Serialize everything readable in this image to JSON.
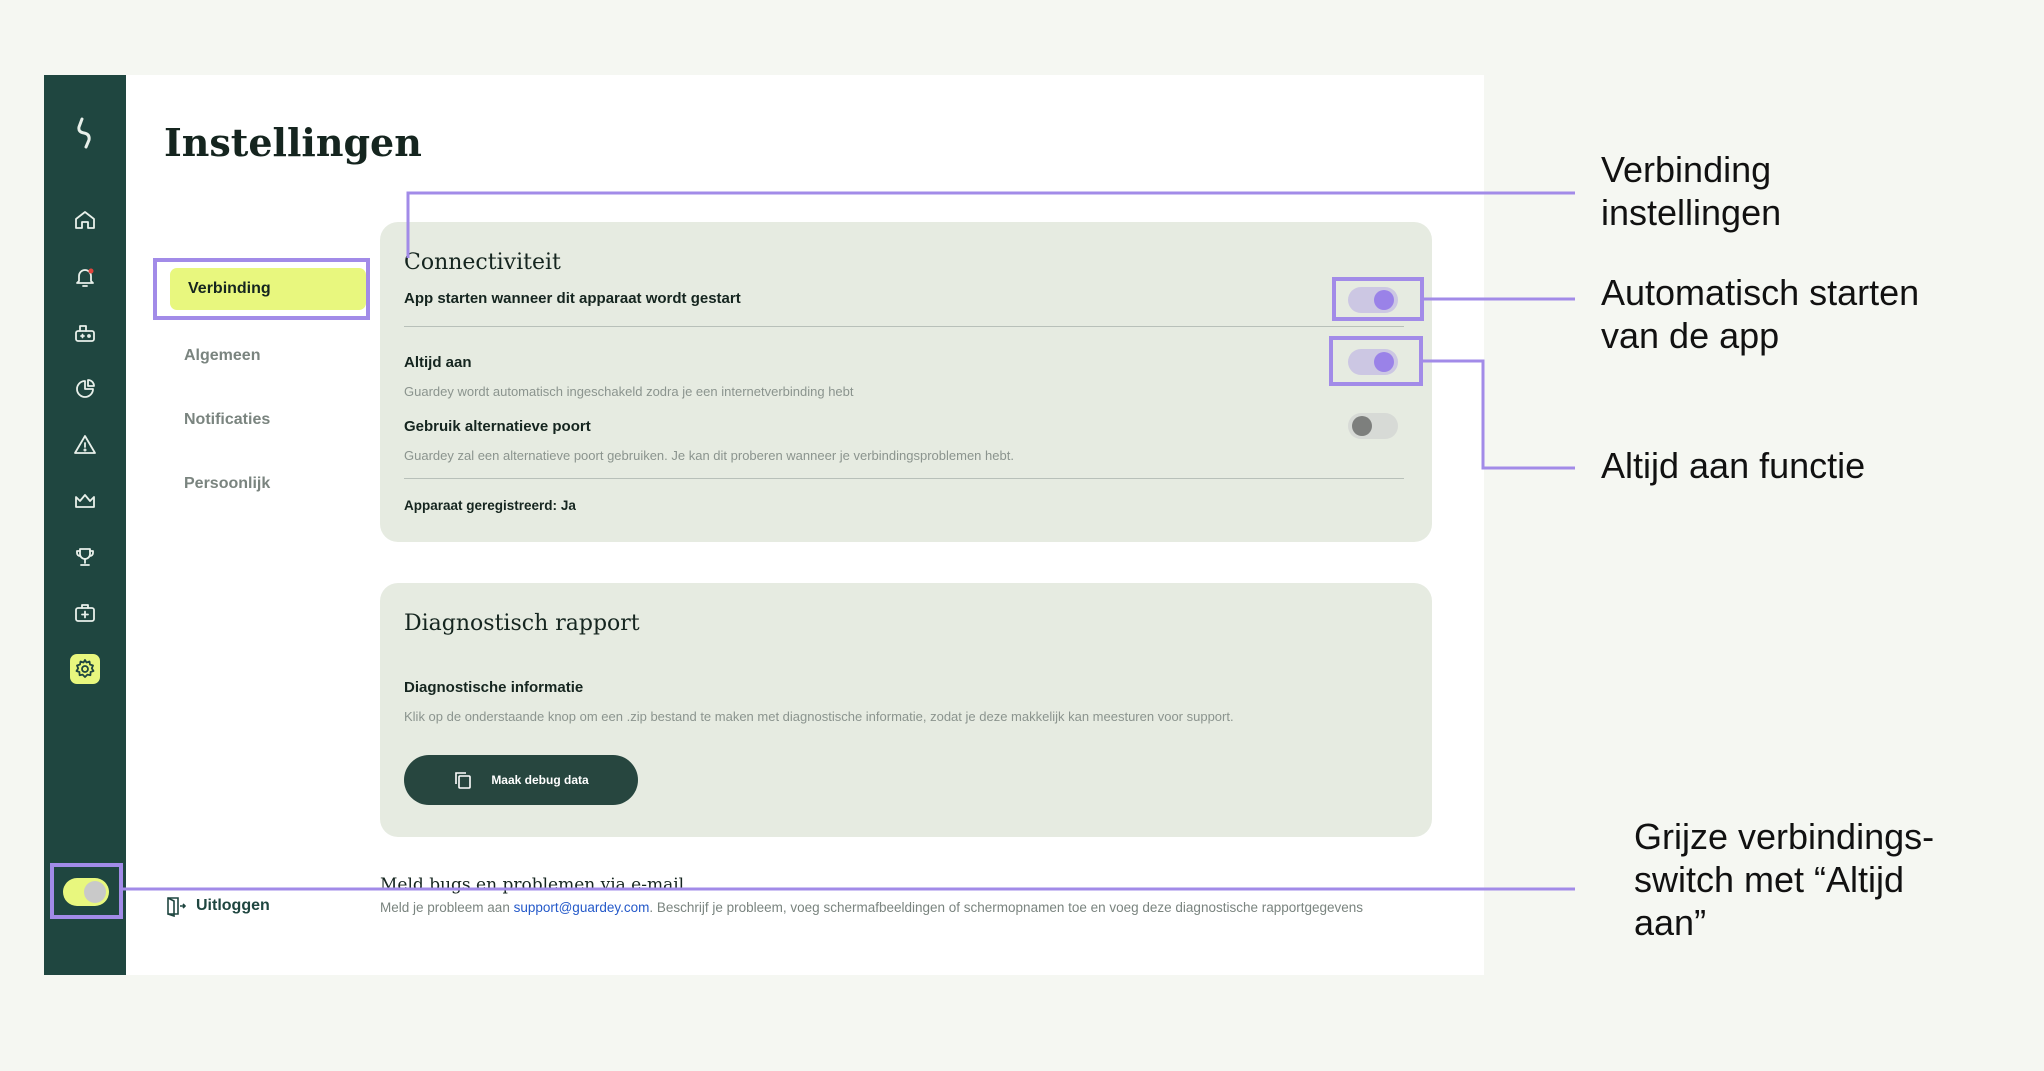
{
  "page": {
    "title": "Instellingen"
  },
  "sidebar": {
    "icons": [
      "logo-icon",
      "home-icon",
      "bell-icon",
      "devices-icon",
      "pie-chart-icon",
      "warning-icon",
      "crown-icon",
      "trophy-icon",
      "first-aid-icon",
      "gear-icon"
    ]
  },
  "subnav": {
    "items": [
      {
        "label": "Verbinding",
        "active": true
      },
      {
        "label": "Algemeen"
      },
      {
        "label": "Notificaties"
      },
      {
        "label": "Persoonlijk"
      }
    ]
  },
  "connectivity": {
    "title": "Connectiviteit",
    "autostart_label": "App starten wanneer dit apparaat wordt gestart",
    "always_on_label": "Altijd aan",
    "always_on_desc": "Guardey wordt automatisch ingeschakeld zodra je een internetverbinding hebt",
    "alt_port_label": "Gebruik alternatieve poort",
    "alt_port_desc": "Guardey zal een alternatieve poort gebruiken. Je kan dit proberen wanneer je verbindingsproblemen hebt.",
    "registered_label": "Apparaat geregistreerd:",
    "registered_value": "Ja"
  },
  "diagnostics": {
    "title": "Diagnostisch rapport",
    "info_label": "Diagnostische informatie",
    "info_desc": "Klik op de onderstaande knop om een .zip bestand te maken met diagnostische informatie, zodat je deze makkelijk kan meesturen voor support.",
    "button_label": "Maak debug data"
  },
  "bugs": {
    "title": "Meld bugs en problemen via e-mail",
    "text_before": "Meld je probleem aan ",
    "email": "support@guardey.com",
    "text_after": ". Beschrijf je probleem, voeg schermafbeeldingen of schermopnamen toe en voeg deze diagnostische rapportgegevens toe."
  },
  "logout": {
    "label": "Uitloggen"
  },
  "annotations": {
    "connection_settings_line1": "Verbinding",
    "connection_settings_line2": "instellingen",
    "autostart_line1": "Automatisch starten",
    "autostart_line2": "van de app",
    "always_on": "Altijd aan functie",
    "grey_switch_line1": "Grijze verbindings-",
    "grey_switch_line2": "switch met “Altijd",
    "grey_switch_line3": "aan”"
  },
  "colors": {
    "accent": "#e8f77e",
    "rail": "#1f4640",
    "highlight": "#a28be8",
    "card": "#e6ebe1"
  }
}
